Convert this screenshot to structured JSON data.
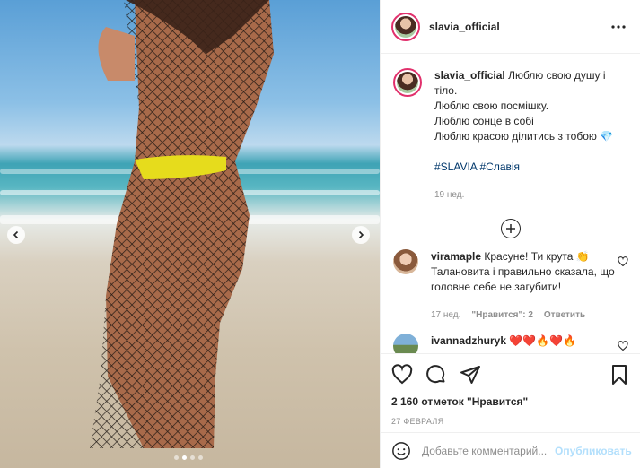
{
  "post": {
    "author": "slavia_official",
    "more_icon": "more-horizontal-icon"
  },
  "caption": {
    "author": "slavia_official",
    "lines": [
      "Люблю свою душу і тіло.",
      "Люблю свою посмішку.",
      "Люблю сонце в собі",
      "Люблю красою ділитись з тобою 💎"
    ],
    "hashtags": "#SLAVIA #Славія",
    "time": "19 нед."
  },
  "comments": [
    {
      "author": "viramaple",
      "text": "Красуне! Ти крута 👏 Талановита і правильно сказала, що головне себе не загубити!",
      "time": "17 нед.",
      "likes": "\"Нравится\": 2",
      "reply": "Ответить"
    },
    {
      "author": "ivannadzhuryk",
      "text": "❤️❤️🔥❤️🔥"
    }
  ],
  "actions": {
    "likes": "2 160 отметок \"Нравится\"",
    "date": "27 ФЕВРАЛЯ"
  },
  "add_comment": {
    "placeholder": "Добавьте комментарий...",
    "publish": "Опубликовать"
  },
  "carousel": {
    "count": 4,
    "active": 2
  },
  "colors": {
    "accent": "#0095f6",
    "publish_disabled": "#b2dffc",
    "hashtag": "#00376b",
    "muted": "#8e8e8e"
  }
}
